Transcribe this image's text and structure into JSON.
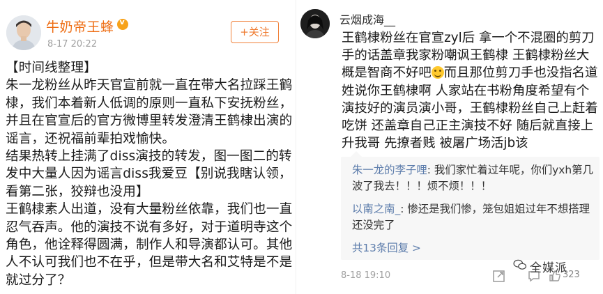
{
  "left_post": {
    "username": "牛奶帝王蜂",
    "timestamp": "8-17 20:22",
    "follow_label": "+关注",
    "body": "【时间线整理】\n朱一龙粉丝从昨天官宣前就一直在带大名拉踩王鹤棣，我们本着新人低调的原则一直私下安抚粉丝，并且在官宣后的官方微博里转发澄清王鹤棣出演的谣言，还祝福前辈拍戏愉快。\n结果热转上挂满了diss演技的转发，图一图二的转发中大量人因为谣言diss我爱豆【别说我瞎认领，看第二张，狡辩也没用】\n王鹤棣素人出道，没有大量粉丝依靠，我们也一直忍气吞声。他的演技不说有多好，对于道明寺这个角色，他诠释得圆满，制作人和导演都认可。其他人不认可我们也不在乎，但是带大名和艾特是不是就过分了？"
  },
  "right_post": {
    "username": "云烟成海__",
    "body_part1": "王鹤棣粉丝在官宣zyl后 拿一个不混圈的剪刀手的话盖章我家粉嘲讽王鹤棣 王鹤棣粉丝大概是智商不好吧",
    "body_part2": "而且那位剪刀手也没指名道姓说你王鹤棣啊 人家站在书粉角度希望有个演技好的演员演小哥，王鹤棣粉丝自己上赶着吃饼 还盖章自己正主演技不好 随后就直接上升我哥 先撩者贱 被屠广场活jb该",
    "comments": [
      {
        "user": "朱一龙的李子哩",
        "text": "我们家忙着过年呢，你们yxh第几波了我去！！！烦不烦！！！"
      },
      {
        "user": "以南之南_",
        "text": "惨还是我们惨，笼包姐姐过年不想搭理还没完了"
      }
    ],
    "more_replies": "共13条回复 >",
    "timestamp": "8-18 19:10",
    "like_count": "323"
  },
  "watermark": {
    "text": "全媒派",
    "icon": "wechat-icon"
  },
  "colors": {
    "username_orange": "#ee6d13",
    "link_blue": "#5c7cab",
    "meta_gray": "#a0a0a0"
  }
}
